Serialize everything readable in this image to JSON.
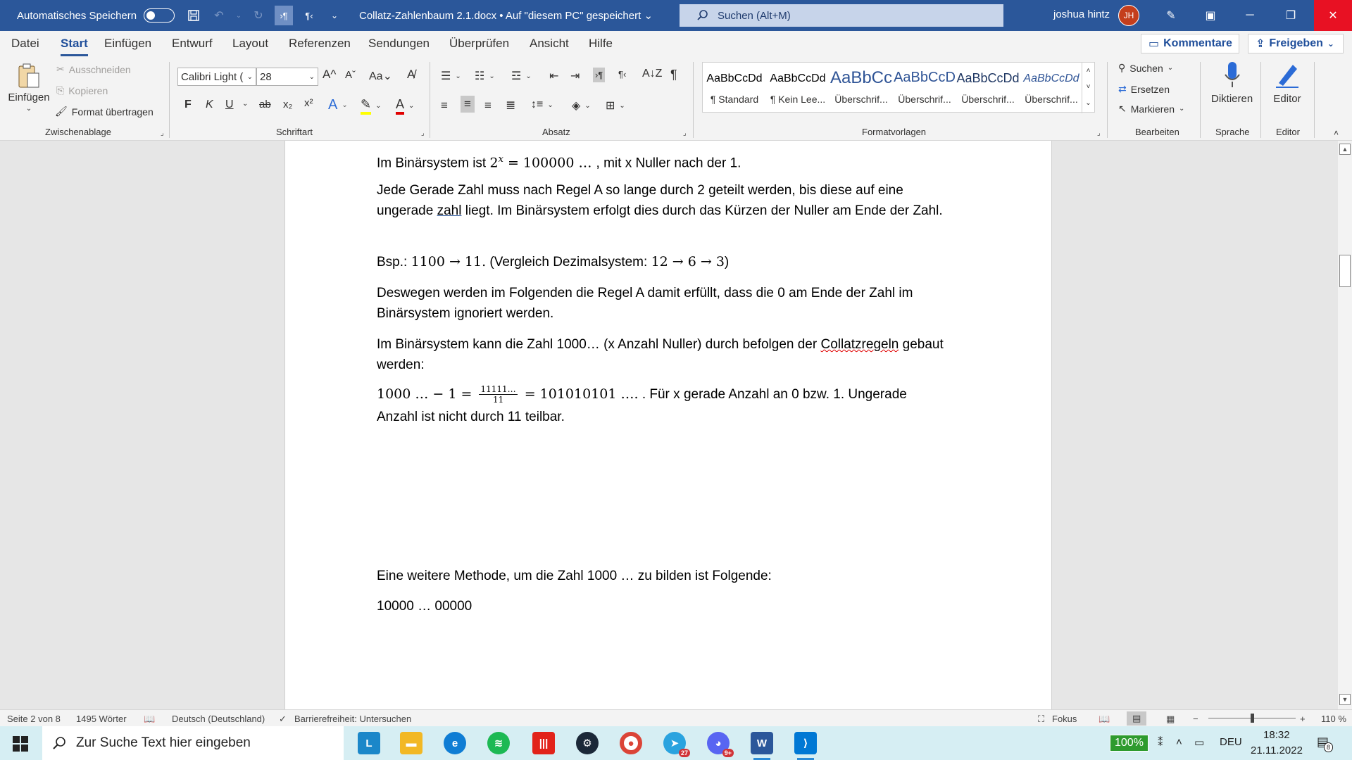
{
  "titlebar": {
    "autosave_label": "Automatisches Speichern",
    "doc_title": "Collatz-Zahlenbaum 2.1.docx • Auf \"diesem PC\" gespeichert",
    "search_placeholder": "Suchen (Alt+M)",
    "user_name": "joshua hintz",
    "user_initials": "JH"
  },
  "menu": {
    "tabs": [
      "Datei",
      "Start",
      "Einfügen",
      "Entwurf",
      "Layout",
      "Referenzen",
      "Sendungen",
      "Überprüfen",
      "Ansicht",
      "Hilfe"
    ],
    "active_tab": "Start",
    "comments_label": "Kommentare",
    "share_label": "Freigeben"
  },
  "ribbon": {
    "clipboard": {
      "paste_label": "Einfügen",
      "cut_label": "Ausschneiden",
      "copy_label": "Kopieren",
      "format_painter_label": "Format übertragen",
      "group_label": "Zwischenablage"
    },
    "font": {
      "font_name": "Calibri Light (",
      "font_size": "28",
      "bold": "F",
      "italic": "K",
      "underline": "U",
      "group_label": "Schriftart"
    },
    "paragraph": {
      "group_label": "Absatz"
    },
    "styles": {
      "items": [
        {
          "preview": "AaBbCcDd",
          "name": "¶ Standard"
        },
        {
          "preview": "AaBbCcDd",
          "name": "¶ Kein Lee..."
        },
        {
          "preview": "AaBbCc",
          "name": "Überschrif..."
        },
        {
          "preview": "AaBbCcD",
          "name": "Überschrif..."
        },
        {
          "preview": "AaBbCcDd",
          "name": "Überschrif..."
        },
        {
          "preview": "AaBbCcDd",
          "name": "Überschrif..."
        }
      ],
      "group_label": "Formatvorlagen"
    },
    "editing": {
      "search_label": "Suchen",
      "replace_label": "Ersetzen",
      "select_label": "Markieren",
      "group_label": "Bearbeiten"
    },
    "voice": {
      "dictate_label": "Diktieren",
      "group_label": "Sprache"
    },
    "editor": {
      "editor_label": "Editor",
      "group_label": "Editor"
    }
  },
  "document": {
    "p1_a": "Im Binärsystem ist ",
    "p1_math": "2",
    "p1_sup": "x",
    "p1_math2": " = 100000 … ",
    "p1_b": ", mit x Nuller nach der 1.",
    "p2_a": "Jede Gerade Zahl muss nach Regel A so lange durch 2 geteilt werden, bis diese auf eine ungerade ",
    "p2_word": "zahl",
    "p2_b": " liegt. Im Binärsystem erfolgt dies durch das Kürzen der Nuller am Ende der Zahl.",
    "p3_a": "Bsp.: ",
    "p3_math": "1100 → 11.",
    "p3_b": " (Vergleich Dezimalsystem: ",
    "p3_math2": "12 → 6 → 3",
    "p3_c": ")",
    "p4": "Deswegen werden im Folgenden die Regel A damit erfüllt, dass die 0 am Ende der Zahl im Binärsystem ignoriert werden.",
    "p5_a": "Im Binärsystem kann die Zahl 1000… (x Anzahl Nuller) durch befolgen der ",
    "p5_word": "Collatzregeln",
    "p5_b": " gebaut werden:",
    "p6_math": "1000  … − 1 = ",
    "p6_num": "11111…",
    "p6_den": "11",
    "p6_math2": " = 101010101 ….",
    "p6_b": " . Für x gerade Anzahl an 0 bzw. 1. Ungerade Anzahl ist nicht durch 11 teilbar.",
    "p7": "Eine weitere Methode, um die Zahl 1000 … zu bilden ist Folgende:",
    "p8": "10000 … 00000"
  },
  "statusbar": {
    "page": "Seite 2 von 8",
    "words": "1495 Wörter",
    "language": "Deutsch (Deutschland)",
    "accessibility": "Barrierefreiheit: Untersuchen",
    "focus": "Fokus",
    "zoom": "110 %"
  },
  "taskbar": {
    "search_placeholder": "Zur Suche Text hier eingeben",
    "battery": "100%",
    "language": "DEU",
    "time": "18:32",
    "date": "21.11.2022",
    "telegram_badge": "27",
    "discord_badge": "9+",
    "notification_count": "8"
  }
}
